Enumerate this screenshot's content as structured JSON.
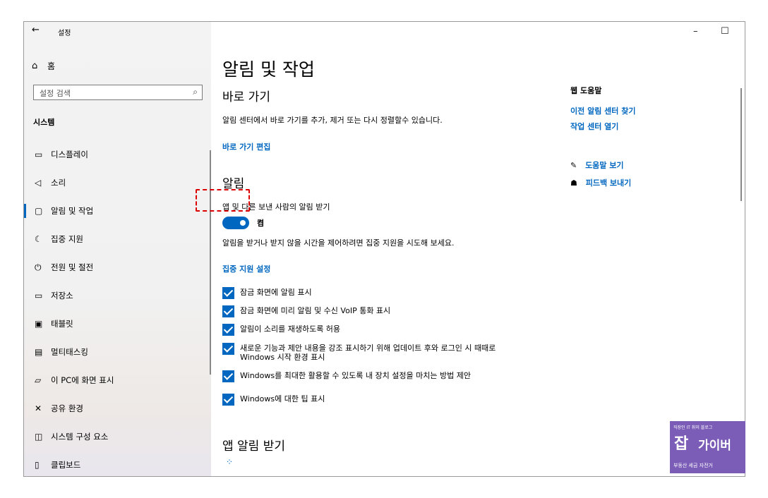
{
  "window": {
    "back_glyph": "←",
    "title": "설정",
    "minimize": "–",
    "maximize": "☐",
    "close": "✕"
  },
  "sidebar": {
    "home_label": "홈",
    "search_placeholder": "설정 검색",
    "section": "시스템",
    "items": [
      {
        "label": "디스플레이",
        "icon": "display-icon"
      },
      {
        "label": "소리",
        "icon": "sound-icon"
      },
      {
        "label": "알림 및 작업",
        "icon": "notification-icon",
        "active": true
      },
      {
        "label": "집중 지원",
        "icon": "moon-icon"
      },
      {
        "label": "전원 및 절전",
        "icon": "power-icon"
      },
      {
        "label": "저장소",
        "icon": "storage-icon"
      },
      {
        "label": "태블릿",
        "icon": "tablet-icon"
      },
      {
        "label": "멀티태스킹",
        "icon": "multitasking-icon"
      },
      {
        "label": "이 PC에 화면 표시",
        "icon": "project-icon"
      },
      {
        "label": "공유 환경",
        "icon": "share-icon"
      },
      {
        "label": "시스템 구성 요소",
        "icon": "components-icon"
      },
      {
        "label": "클립보드",
        "icon": "clipboard-icon"
      }
    ]
  },
  "main": {
    "title": "알림 및 작업",
    "quick": {
      "heading": "바로 가기",
      "description": "알림 센터에서 바로 가기를 추가, 제거 또는 다시 정렬할수 있습니다.",
      "edit_link": "바로 가기 편집"
    },
    "notifications": {
      "heading": "알림",
      "toggle_title": "앱 및 다른 보낸 사람의 알림 받기",
      "toggle_state": "켬",
      "toggle_on": true,
      "focus_hint": "알림을 받거나 받지 않을 시간을 제어하려면 집중 지원을 시도해 보세요.",
      "focus_link": "집중 지원 설정",
      "checkboxes": [
        "잠금 화면에 알림 표시",
        "잠금 화면에 미리 알림 및 수신 VoIP 통화 표시",
        "알림이 소리를 재생하도록 허용",
        "새로운 기능과 제안 내용을 강조 표시하기 위해 업데이트 후와 로그인 시 때때로 Windows 시작 환경 표시",
        "Windows를 최대한 활용할 수 있도록 내 장치 설정을 마치는 방법 제안",
        "Windows에 대한 팁 표시"
      ]
    },
    "app_notifications": {
      "heading": "앱 알림 받기"
    }
  },
  "help": {
    "heading": "웹 도움말",
    "links": [
      "이전 알림 센터 찾기",
      "작업 센터 열기"
    ],
    "get_help": "도움말 보기",
    "feedback": "피드백 보내기"
  },
  "watermark": {
    "line1": "직장인 IT 취미 블로그",
    "line2a": "잡",
    "line2b": "가이버",
    "line3": "부동산 세금 자전거"
  },
  "colors": {
    "accent": "#0067c0",
    "highlight": "#dd0000",
    "badge": "#7b5db8"
  }
}
